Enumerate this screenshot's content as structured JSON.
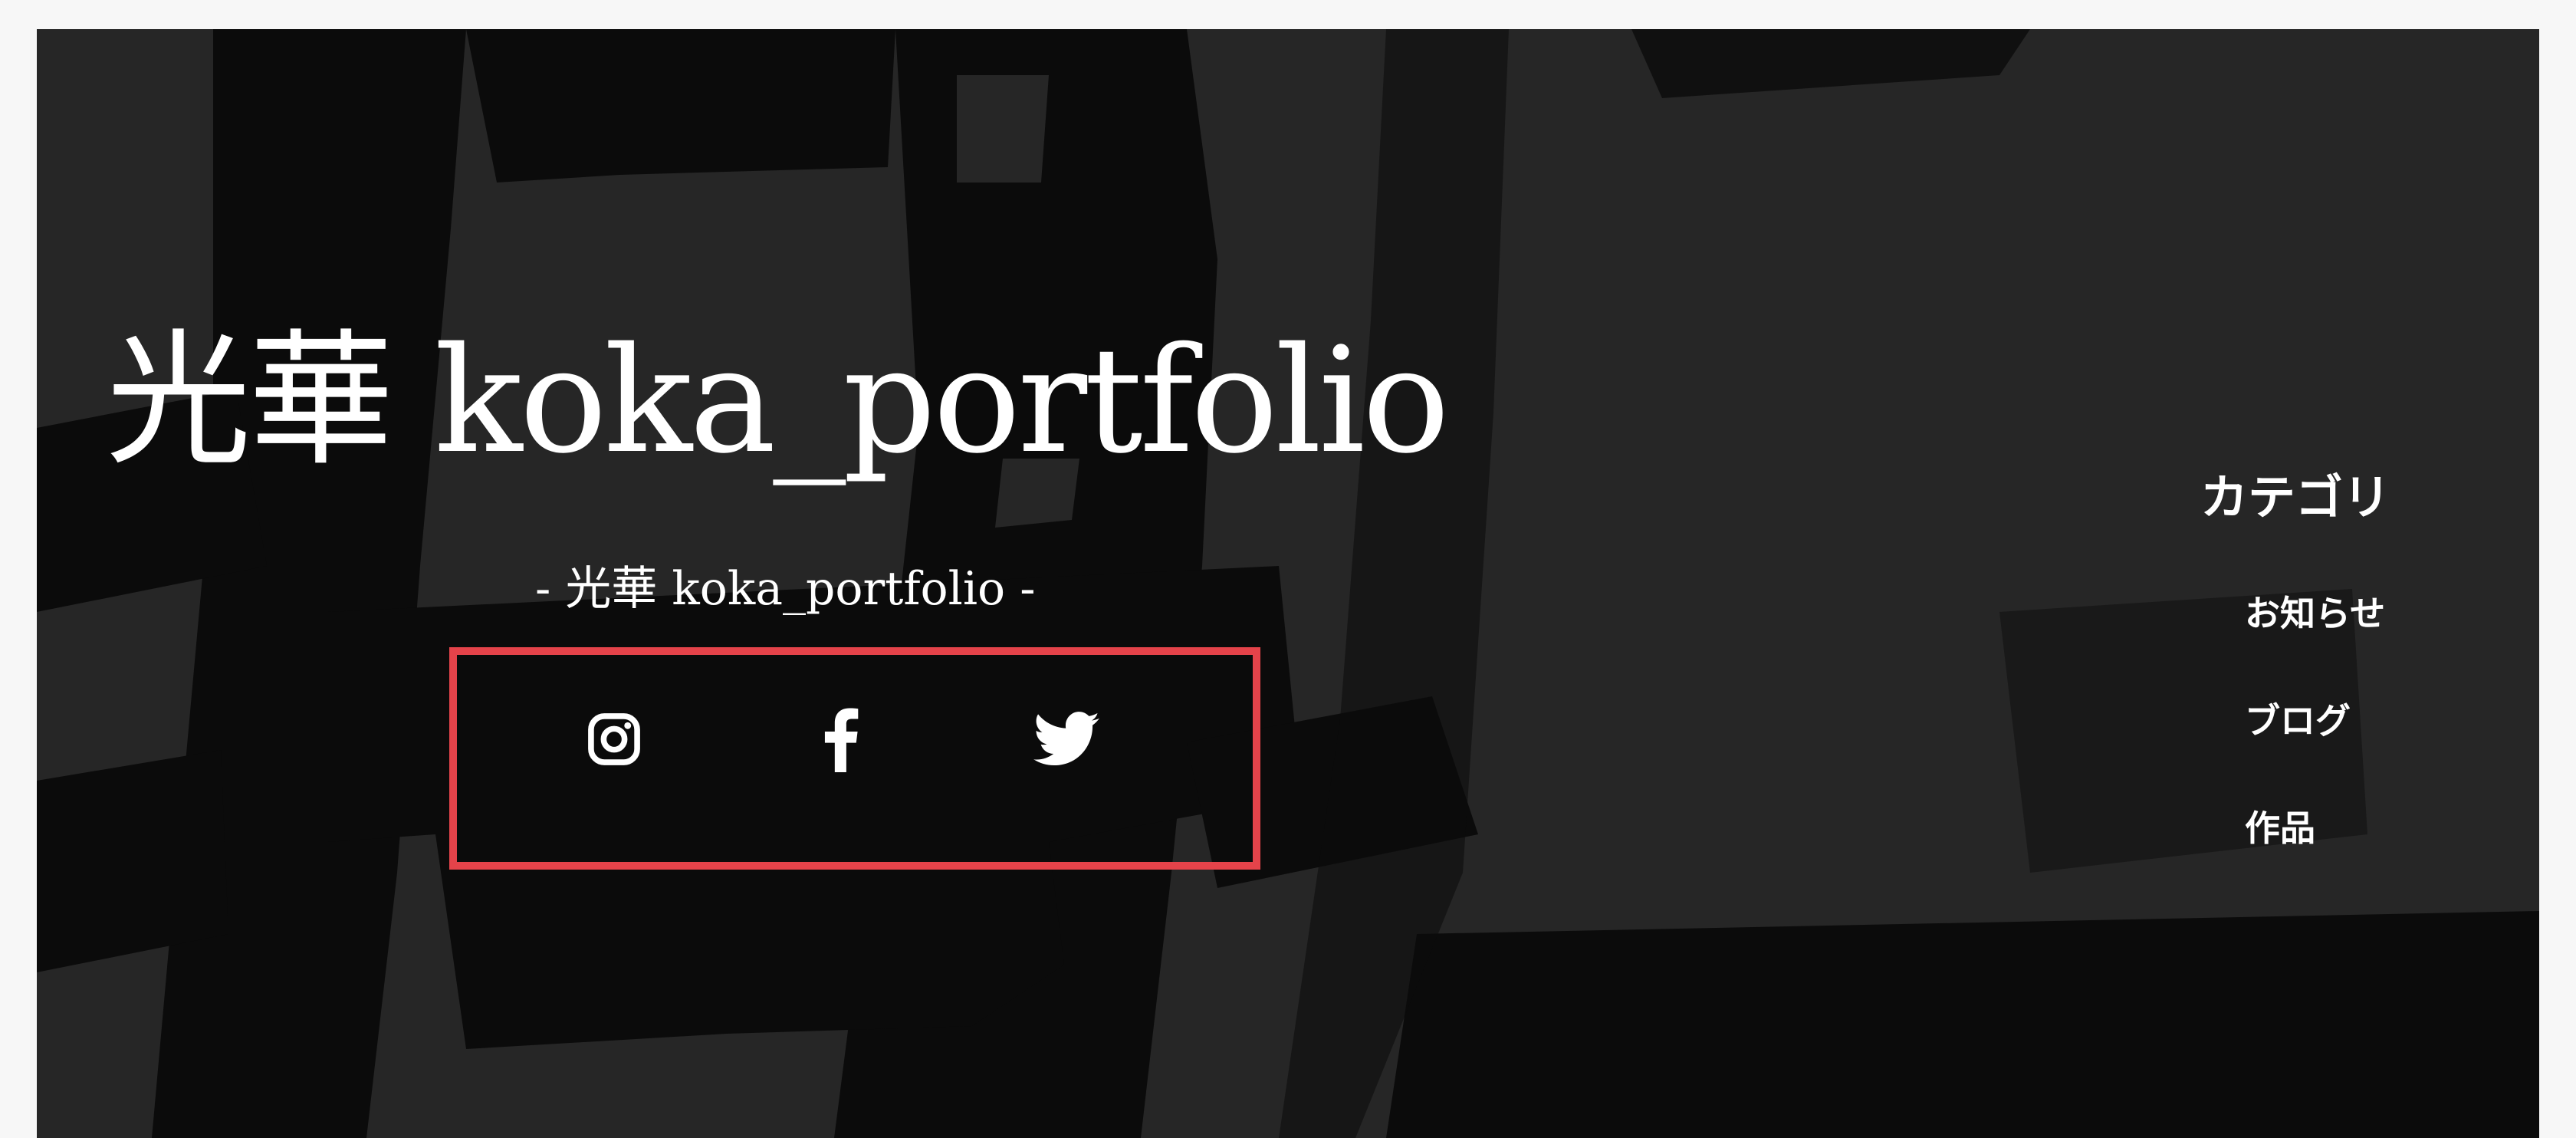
{
  "site": {
    "title": "光華 koka_portfolio",
    "subtitle": "- 光華 koka_portfolio -"
  },
  "social": {
    "items": [
      {
        "name": "instagram",
        "icon": "instagram-icon"
      },
      {
        "name": "facebook",
        "icon": "facebook-icon"
      },
      {
        "name": "twitter",
        "icon": "twitter-icon"
      }
    ],
    "highlight_color": "#e5434a"
  },
  "sidebar": {
    "heading": "カテゴリ",
    "items": [
      {
        "label": "お知らせ"
      },
      {
        "label": "ブログ"
      },
      {
        "label": "作品"
      }
    ]
  },
  "colors": {
    "background": "#262626",
    "brush": "#0b0b0b",
    "text": "#ffffff"
  }
}
